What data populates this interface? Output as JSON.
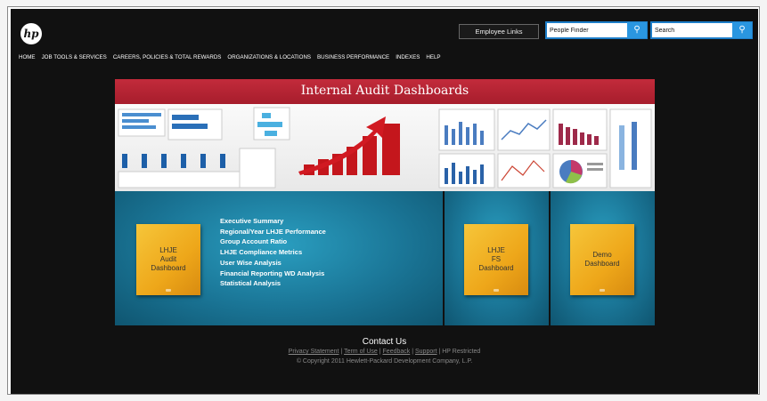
{
  "header": {
    "logo_text": "hp",
    "employee_links_label": "Employee Links",
    "people_finder_value": "People Finder",
    "search_value": "Search"
  },
  "nav": {
    "items": [
      "HOME",
      "JOB TOOLS & SERVICES",
      "CAREERS, POLICIES & TOTAL REWARDS",
      "ORGANIZATIONS & LOCATIONS",
      "BUSINESS PERFORMANCE",
      "INDEXES",
      "HELP"
    ]
  },
  "banner": {
    "title": "Internal Audit Dashboards"
  },
  "dashboards": {
    "audit_tile": [
      "LHJE",
      "Audit",
      "Dashboard"
    ],
    "summary_links": [
      "Executive Summary",
      "Regional/Year LHJE Performance",
      "Group Account Ratio",
      "LHJE Compliance Metrics",
      "User Wise Analysis",
      "Financial Reporting WD Analysis",
      "Statistical Analysis"
    ],
    "fs_tile": [
      "LHJE",
      "FS",
      "Dashboard"
    ],
    "demo_tile": [
      "Demo",
      "Dashboard"
    ]
  },
  "footer": {
    "contact": "Contact Us",
    "links": [
      "Privacy Statement",
      "Term of Use",
      "Feedback",
      "Support"
    ],
    "restricted": "HP Restricted",
    "copyright": "© Copyright 2011 Hewlett-Packard Development Company, L.P."
  },
  "colors": {
    "background": "#111111",
    "banner_red": "#b02232",
    "panel_teal": "#1a7596",
    "tile_gold": "#f2b52a",
    "search_blue": "#1e7ec8"
  }
}
